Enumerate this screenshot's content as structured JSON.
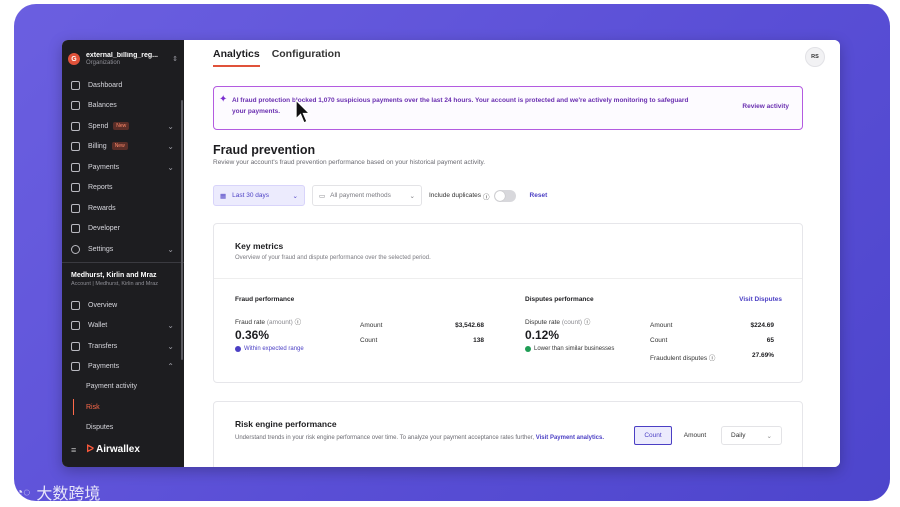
{
  "sidebar": {
    "org": {
      "badge": "G",
      "name": "external_billing_reg...",
      "sub": "Organization"
    },
    "items": [
      {
        "label": "Dashboard"
      },
      {
        "label": "Balances"
      },
      {
        "label": "Spend",
        "badge": "New"
      },
      {
        "label": "Billing",
        "badge": "New"
      },
      {
        "label": "Payments"
      },
      {
        "label": "Reports"
      },
      {
        "label": "Rewards"
      },
      {
        "label": "Developer"
      },
      {
        "label": "Settings"
      }
    ],
    "account": {
      "name": "Medhurst, Kirlin and Mraz",
      "sub": "Account | Medhurst, Kirlin and Mraz"
    },
    "account_items": [
      {
        "label": "Overview"
      },
      {
        "label": "Wallet"
      },
      {
        "label": "Transfers"
      },
      {
        "label": "Payments"
      }
    ],
    "payments_sub": [
      "Payment activity",
      "Risk",
      "Disputes"
    ],
    "logo": "Airwallex"
  },
  "tabs": [
    "Analytics",
    "Configuration"
  ],
  "avatar": "RS",
  "banner": {
    "text": "AI fraud protection blocked 1,070 suspicious payments over the last 24 hours. Your account is protected and we're actively monitoring to safeguard your payments.",
    "link": "Review activity"
  },
  "page": {
    "title": "Fraud prevention",
    "subtitle": "Review your account's fraud prevention performance based on your historical payment activity."
  },
  "filters": {
    "date": "Last 30 days",
    "payment_methods": "All payment methods",
    "include_duplicates": "Include duplicates",
    "reset": "Reset"
  },
  "key_metrics": {
    "title": "Key metrics",
    "subtitle": "Overview of your fraud and dispute performance over the selected period.",
    "fraud": {
      "title": "Fraud performance",
      "rate_label": "Fraud rate",
      "rate_unit": "(amount)",
      "rate": "0.36%",
      "note": "Within expected range",
      "rows": [
        {
          "k": "Amount",
          "v": "$3,542.68"
        },
        {
          "k": "Count",
          "v": "138"
        }
      ]
    },
    "disputes": {
      "title": "Disputes performance",
      "link": "Visit Disputes",
      "rate_label": "Dispute rate",
      "rate_unit": "(count)",
      "rate": "0.12%",
      "note": "Lower than similar businesses",
      "rows": [
        {
          "k": "Amount",
          "v": "$224.69"
        },
        {
          "k": "Count",
          "v": "65"
        },
        {
          "k": "Fraudulent disputes",
          "v": "27.69%"
        }
      ]
    }
  },
  "risk_engine": {
    "title": "Risk engine performance",
    "subtitle": "Understand trends in your risk engine performance over time. To analyze your payment acceptance rates further,",
    "link_visit": "Visit",
    "link": "Payment analytics.",
    "toggle": [
      "Count",
      "Amount"
    ],
    "granularity": "Daily"
  },
  "watermark": "大数跨境",
  "colors": {
    "accent": "#4b3fc4",
    "brand": "#e0523a",
    "banner": "#b35be0",
    "sidebar": "#1d1d20"
  }
}
